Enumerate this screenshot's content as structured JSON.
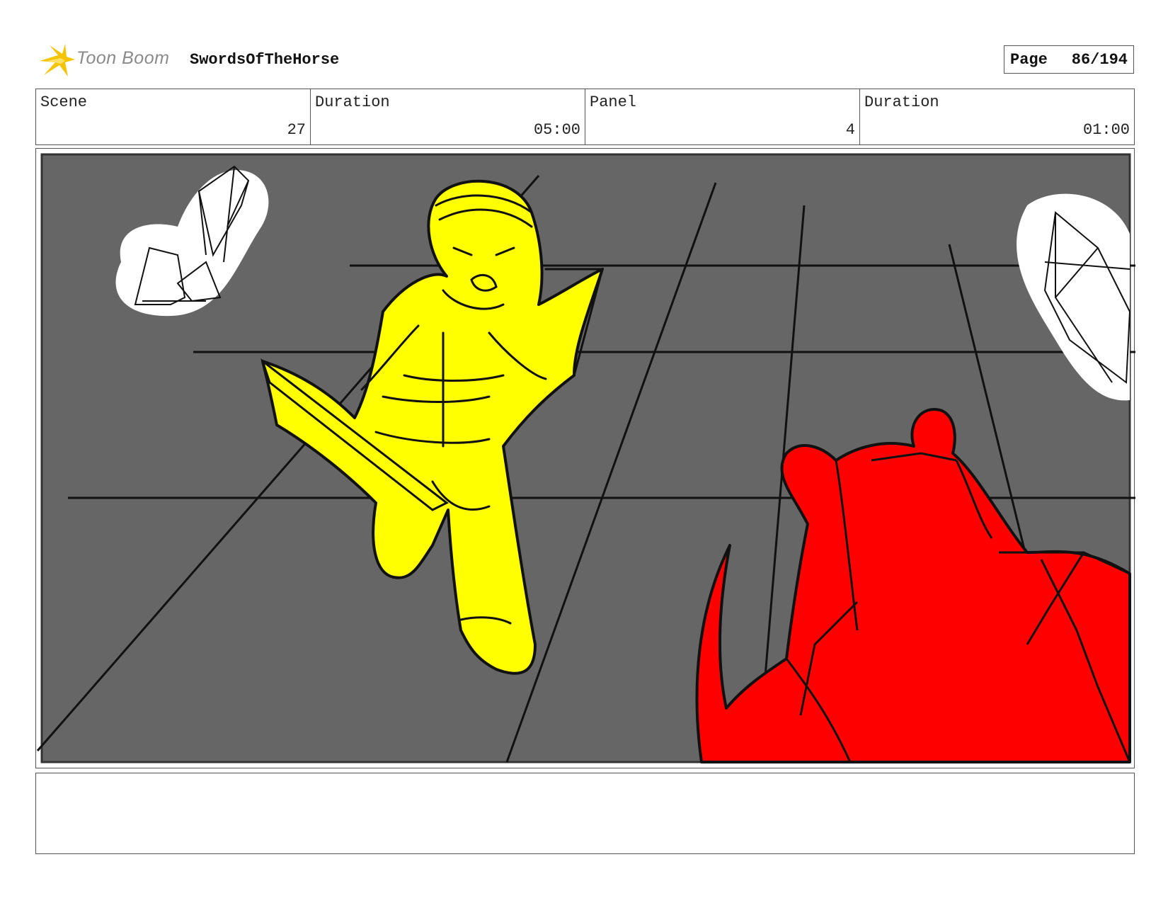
{
  "header": {
    "logo_text": "Toon Boom",
    "project_title": "SwordsOfTheHorse",
    "page_label": "Page",
    "page_number": "86/194"
  },
  "info": {
    "scene_label": "Scene",
    "scene_value": "27",
    "scene_duration_label": "Duration",
    "scene_duration_value": "05:00",
    "panel_label": "Panel",
    "panel_value": "4",
    "panel_duration_label": "Duration",
    "panel_duration_value": "01:00"
  },
  "colors": {
    "floor": "#666666",
    "hero": "#ffff00",
    "creature": "#ff0000",
    "accent_logo": "#f5c400"
  },
  "notes": {
    "text": ""
  }
}
